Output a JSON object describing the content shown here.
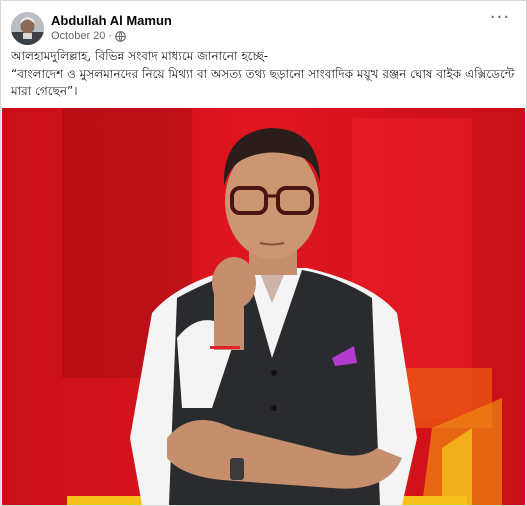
{
  "post": {
    "author": "Abdullah Al Mamun",
    "date": "October 20",
    "separator": "·",
    "privacy_icon": "globe-icon",
    "menu_icon": "more-options-icon",
    "menu_label": "···",
    "text_line1": "আলহামদুলিল্লাহ, বিভিন্ন সংবাদ মাধ্যমে জানানো হচ্ছে-",
    "text_line2": "“বাংলাদেশ ও মুসলমানদের নিয়ে মিথ্যা বা অসত্য তথ্য ছড়ানো সাংবাদিক ময়ূখ রঞ্জন ঘোষ বাইক এক্সিডেন্টে মারা গেছেন”।"
  },
  "colors": {
    "photo_background": "#d8141d",
    "accent_yellow": "#f5c21b"
  }
}
